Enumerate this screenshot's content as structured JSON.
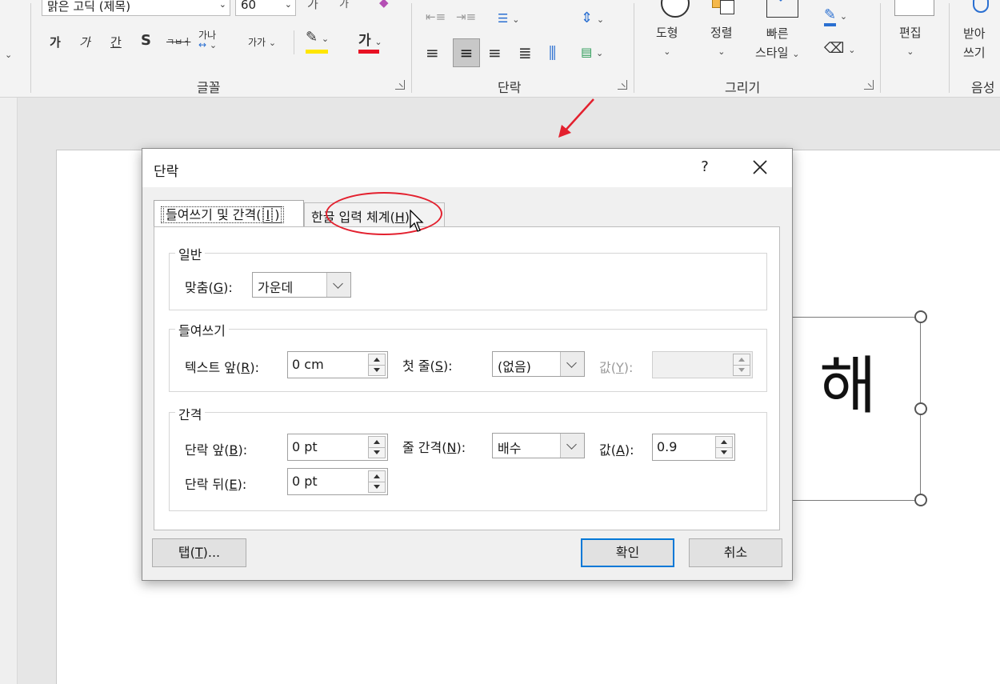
{
  "ribbon": {
    "font_name": "맑은 고딕 (제목)",
    "font_size": "60",
    "font_group_label": "글꼴",
    "font_buttons": {
      "grow": "가",
      "shrink": "가",
      "bold": "가",
      "italic": "가",
      "underline": "간",
      "shadow": "S",
      "strike": "ㅋㅂㅓ",
      "spacing": "가나",
      "case": "가가",
      "highlight": "가"
    },
    "paragraph_group_label": "단락",
    "drawing_group_label": "그리기",
    "shape_label": "도형",
    "arrange_label": "정렬",
    "quick_style_line1": "빠른",
    "quick_style_line2": "스타일",
    "edit_label": "편집",
    "dictate_line1": "받아",
    "dictate_line2": "쓰기",
    "voice_group_label": "음성"
  },
  "document": {
    "textbox_char": "해"
  },
  "dialog": {
    "title": "단락",
    "help": "?",
    "tabs": [
      {
        "label": "들여쓰기 및 간격(",
        "key": "I",
        "tail": ")"
      },
      {
        "label": "한글 입력 체계(",
        "key": "H",
        "tail": ")"
      }
    ],
    "general": {
      "legend": "일반",
      "alignment_label": "맞춤(",
      "alignment_key": "G",
      "alignment_tail": "):",
      "alignment_value": "가운데"
    },
    "indent": {
      "legend": "들여쓰기",
      "before_label": "텍스트 앞(",
      "before_key": "R",
      "before_tail": "):",
      "before_value": "0 cm",
      "first_line_label": "첫 줄(",
      "first_line_key": "S",
      "first_line_tail": "):",
      "first_line_value": "(없음)",
      "by_label": "값(",
      "by_key": "Y",
      "by_tail": "):",
      "by_value": ""
    },
    "spacing": {
      "legend": "간격",
      "before_label": "단락 앞(",
      "before_key": "B",
      "before_tail": "):",
      "before_value": "0 pt",
      "after_label": "단락 뒤(",
      "after_key": "E",
      "after_tail": "):",
      "after_value": "0 pt",
      "line_label": "줄 간격(",
      "line_key": "N",
      "line_tail": "):",
      "line_value": "배수",
      "at_label": "값(",
      "at_key": "A",
      "at_tail": "):",
      "at_value": "0.9"
    },
    "buttons": {
      "tabs_label": "탭(",
      "tabs_key": "T",
      "tabs_tail": ")...",
      "ok": "확인",
      "cancel": "취소"
    }
  },
  "colors": {
    "annotation": "#e3202e",
    "highlight_bar": "#ffe600",
    "font_color_bar": "#e81123",
    "accent": "#0078d7"
  }
}
